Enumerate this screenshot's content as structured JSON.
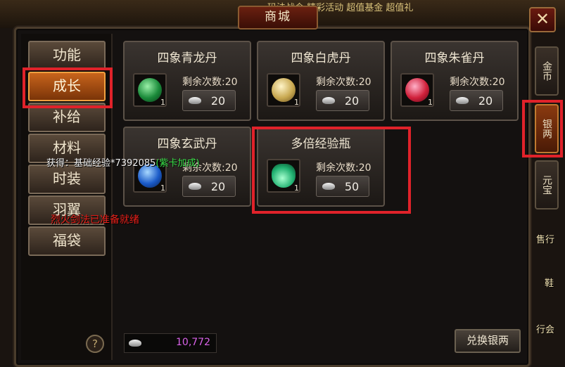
{
  "top_bar": {
    "text": "玛法战令  精彩活动  超值基金  超值礼"
  },
  "window": {
    "title": "商城",
    "close_label": "✕"
  },
  "categories": [
    {
      "label": "功能",
      "active": false
    },
    {
      "label": "成长",
      "active": true
    },
    {
      "label": "补给",
      "active": false
    },
    {
      "label": "材料",
      "active": false
    },
    {
      "label": "时装",
      "active": false
    },
    {
      "label": "羽翼",
      "active": false
    },
    {
      "label": "福袋",
      "active": false
    }
  ],
  "items": [
    {
      "name": "四象青龙丹",
      "remain_label": "剩余次数:20",
      "price": "20",
      "qty": "1",
      "icon": "green-orb-icon",
      "color": "#2aa84a"
    },
    {
      "name": "四象白虎丹",
      "remain_label": "剩余次数:20",
      "price": "20",
      "qty": "1",
      "icon": "gold-tiger-orb-icon",
      "color": "#d8c070"
    },
    {
      "name": "四象朱雀丹",
      "remain_label": "剩余次数:20",
      "price": "20",
      "qty": "1",
      "icon": "red-swirl-orb-icon",
      "color": "#d83050"
    },
    {
      "name": "四象玄武丹",
      "remain_label": "剩余次数:20",
      "price": "20",
      "qty": "1",
      "icon": "blue-turtle-orb-icon",
      "color": "#2a6ad8"
    },
    {
      "name": "多倍经验瓶",
      "remain_label": "剩余次数:20",
      "price": "50",
      "qty": "1",
      "icon": "green-potion-bottle-icon",
      "color": "#3ad890"
    }
  ],
  "side_tabs": [
    {
      "label": "金币",
      "active": false
    },
    {
      "label": "银两",
      "active": true
    },
    {
      "label": "元宝",
      "active": false
    }
  ],
  "right_deco": [
    "售行",
    "鞋",
    "行会"
  ],
  "balance": {
    "value": "10,772"
  },
  "exchange_label": "兑换银两",
  "messages": {
    "exp_prefix": "获得：基础经验*7392085",
    "exp_suffix": "(紫卡加成)",
    "skill_ready": "烈火剑法已准备就绪"
  },
  "help_label": "?",
  "colors": {
    "accent_active": "#c8641c",
    "highlight_box": "#e0222a",
    "balance_text": "#d862e8"
  }
}
